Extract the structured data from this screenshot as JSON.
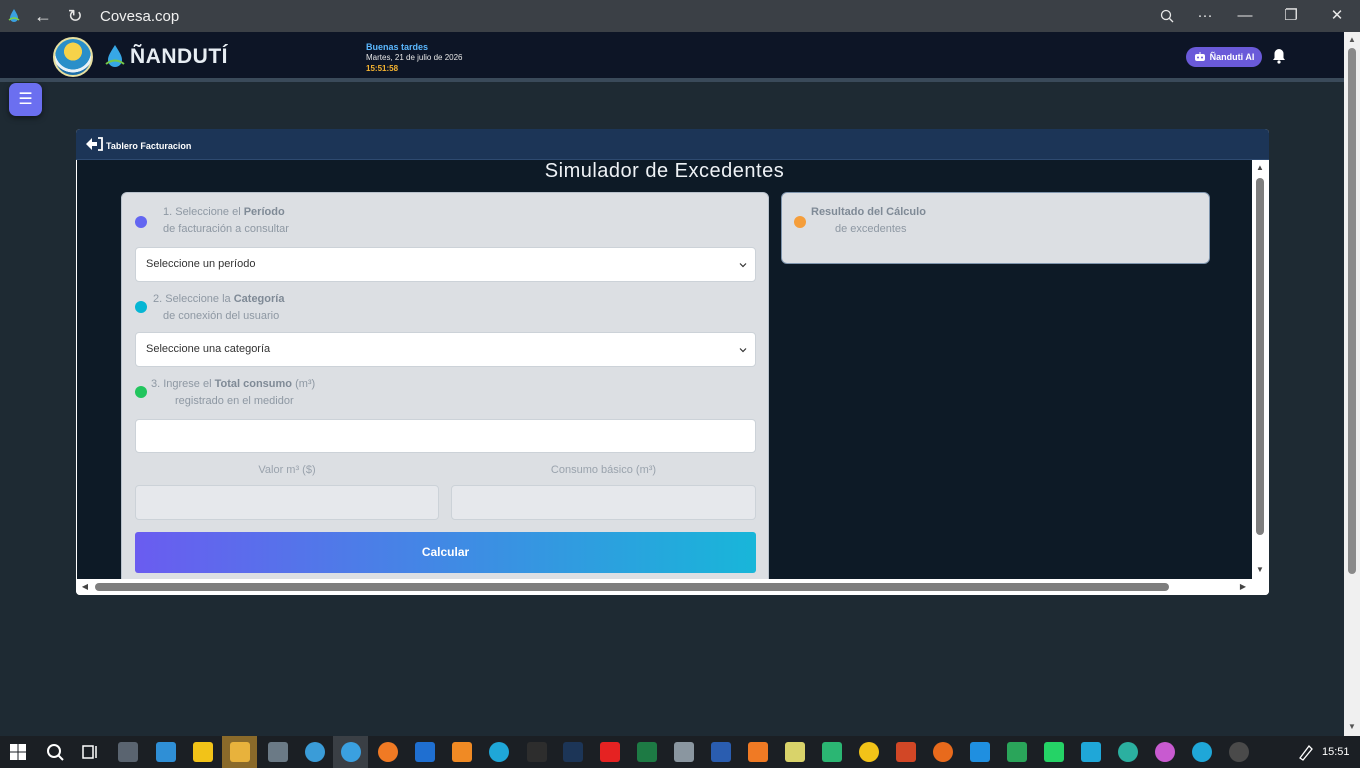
{
  "browser": {
    "tab_title": "Covesa.cop"
  },
  "header": {
    "brand": "ÑANDUTÍ",
    "greeting": "Buenas tardes",
    "date": "Martes, 21 de julio de 2026",
    "time": "15:51:58",
    "ai_button": "Ñanduti AI"
  },
  "modal": {
    "header_title": "Tablero Facturacion",
    "title": "Simulador de Excedentes",
    "step1": {
      "pre": "1. Seleccione el ",
      "bold": "Período",
      "line2": "de facturación a consultar"
    },
    "period_select": "Seleccione un período",
    "step2": {
      "pre": "2. Seleccione la ",
      "bold": "Categoría",
      "line2": "de conexión del usuario"
    },
    "category_select": "Seleccione una categoría",
    "step3": {
      "pre": "3. Ingrese el ",
      "bold": "Total consumo",
      "post": " (m³)",
      "line2": "registrado en el medidor"
    },
    "valor_label": "Valor m³ ($)",
    "consumo_label": "Consumo básico (m³)",
    "calc_button": "Calcular",
    "result": {
      "bold": "Resultado del Cálculo",
      "line2": "de excedentes"
    }
  },
  "colors": {
    "step1_dot": "#6366f1",
    "step2_dot": "#06b6d4",
    "step3_dot": "#22c55e",
    "result_dot": "#f59e3b",
    "button_start": "#6a5cf0",
    "button_end": "#18b6d9"
  },
  "taskbar": {
    "clock": "15:51"
  }
}
